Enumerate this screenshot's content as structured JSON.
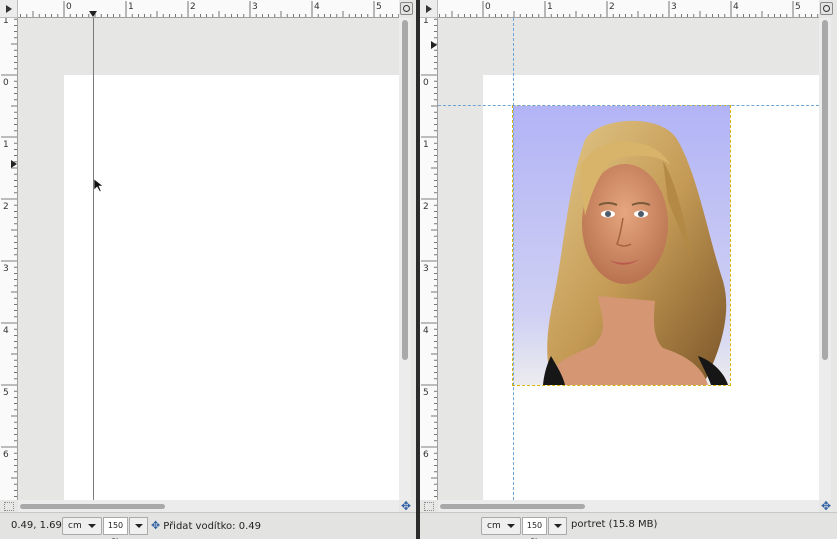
{
  "left_window": {
    "ruler_h_labels": [
      "0",
      "1",
      "2",
      "3",
      "4",
      "5"
    ],
    "ruler_v_labels": [
      "1",
      "0",
      "1",
      "2",
      "3",
      "4",
      "5",
      "6"
    ],
    "status": {
      "coordinates": "0.49, 1.69",
      "unit": "cm",
      "zoom": "150 %",
      "message": "Přidat vodítko: 0.49"
    }
  },
  "right_window": {
    "ruler_h_labels": [
      "0",
      "1",
      "2",
      "3",
      "4",
      "5"
    ],
    "ruler_v_labels": [
      "1",
      "0",
      "1",
      "2",
      "3",
      "4",
      "5",
      "6"
    ],
    "status": {
      "unit": "cm",
      "zoom": "150 %",
      "image_info": "portret (15.8 MB)"
    }
  },
  "icons": {
    "corner": "menu-arrow-icon",
    "zoom": "zoom-icon",
    "navigate": "move-arrows-icon",
    "quickmask": "quick-mask-icon"
  },
  "colors": {
    "canvas_bg": "#e6e6e4",
    "page": "#ffffff",
    "guide_dashed": "#6fa3d4",
    "layer_boundary": "#d8b400",
    "photo_bg": "#b2b4f6"
  }
}
